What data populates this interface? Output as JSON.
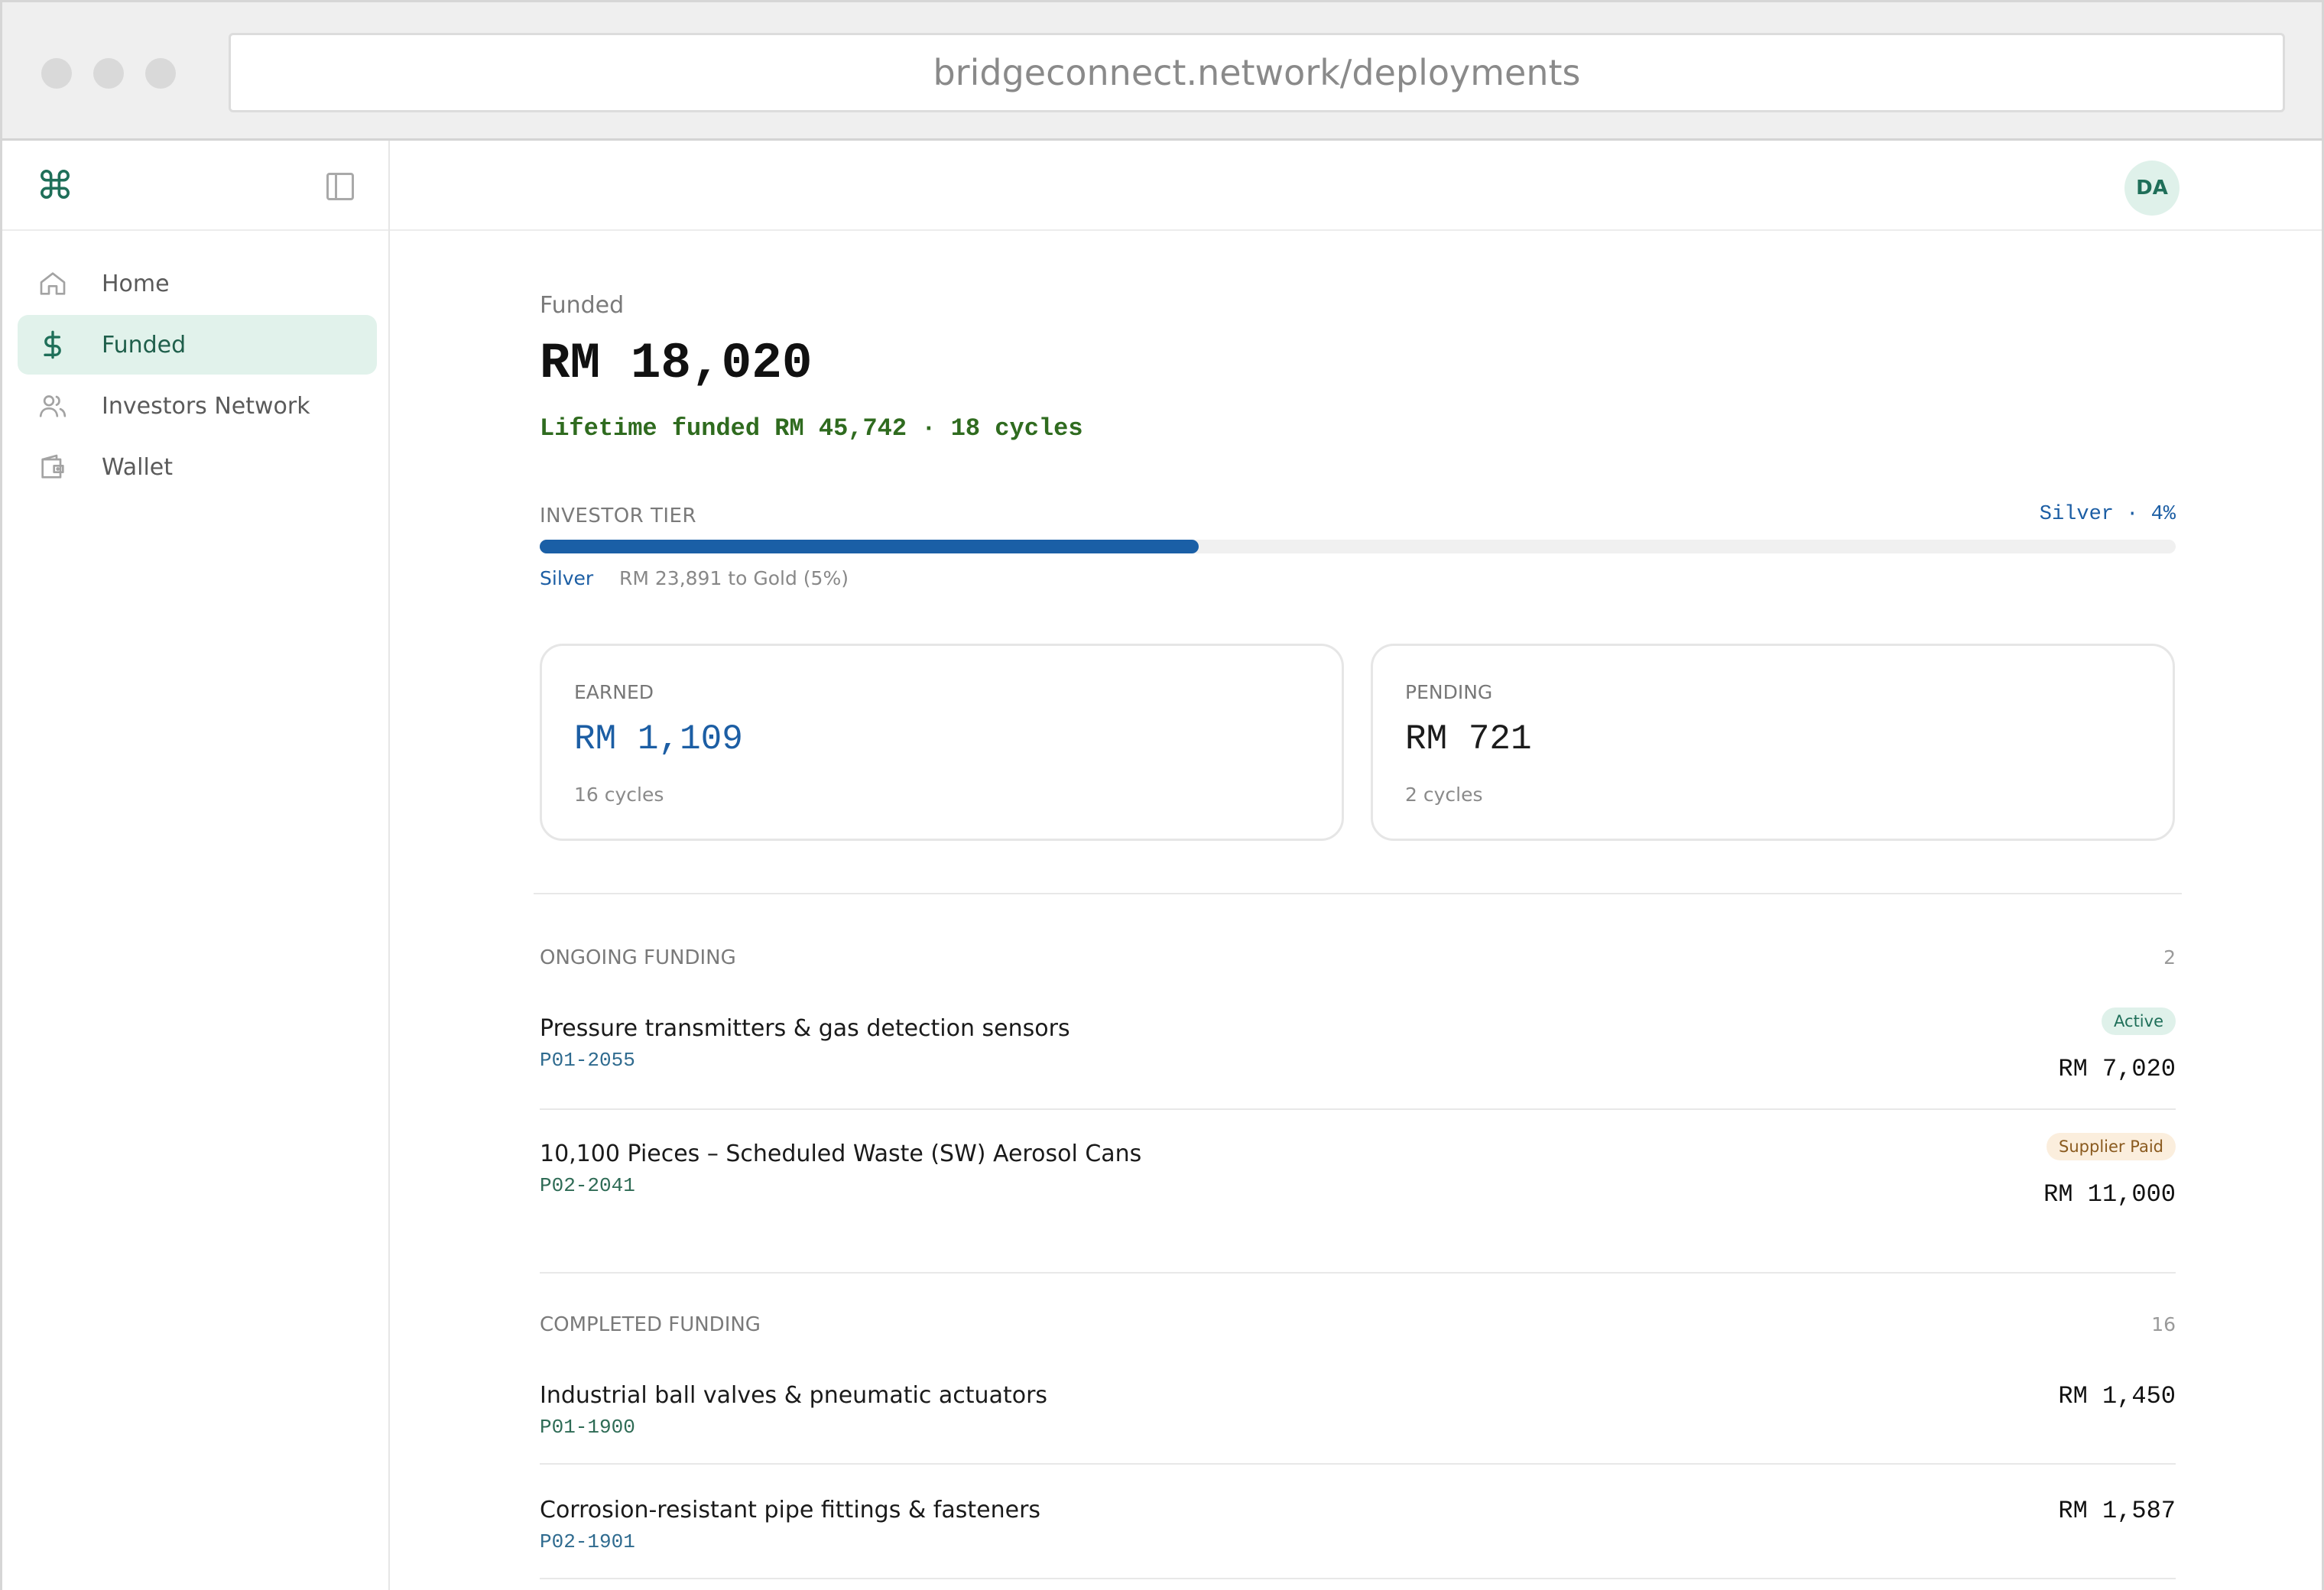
{
  "browser": {
    "url": "bridgeconnect.network/deployments"
  },
  "sidebar": {
    "logo_icon": "command-icon",
    "items": [
      {
        "label": "Home",
        "icon": "home-icon",
        "active": false
      },
      {
        "label": "Funded",
        "icon": "dollar-icon",
        "active": true
      },
      {
        "label": "Investors Network",
        "icon": "users-icon",
        "active": false
      },
      {
        "label": "Wallet",
        "icon": "wallet-icon",
        "active": false
      }
    ]
  },
  "topbar": {
    "avatar_initials": "DA"
  },
  "summary": {
    "label": "Funded",
    "amount": "RM 18,020",
    "lifetime": "Lifetime funded RM 45,742 · 18 cycles"
  },
  "tier": {
    "label": "INVESTOR TIER",
    "right": "Silver · 4%",
    "progress_fraction": 0.403,
    "name": "Silver",
    "note": "RM 23,891 to Gold (5%)"
  },
  "cards": [
    {
      "label": "EARNED",
      "value": "RM 1,109",
      "sub": "16 cycles"
    },
    {
      "label": "PENDING",
      "value": "RM 721",
      "sub": "2 cycles"
    }
  ],
  "ongoing": {
    "title": "ONGOING FUNDING",
    "count": "2",
    "rows": [
      {
        "title": "Pressure transmitters & gas detection sensors",
        "id": "P01-2055",
        "badge": "Active",
        "amount": "RM 7,020"
      },
      {
        "title": "10,100 Pieces – Scheduled Waste (SW) Aerosol Cans",
        "id": "P02-2041",
        "badge": "Supplier Paid",
        "amount": "RM 11,000"
      }
    ]
  },
  "completed": {
    "title": "COMPLETED FUNDING",
    "count": "16",
    "rows": [
      {
        "title": "Industrial ball valves & pneumatic actuators",
        "id": "P01-1900",
        "amount": "RM 1,450"
      },
      {
        "title": "Corrosion-resistant pipe fittings & fasteners",
        "id": "P02-1901",
        "amount": "RM 1,587"
      }
    ]
  },
  "colors": {
    "brand": "#1f6f59",
    "accent_blue": "#1a5fa6",
    "active_bg": "#e1f2eb"
  }
}
